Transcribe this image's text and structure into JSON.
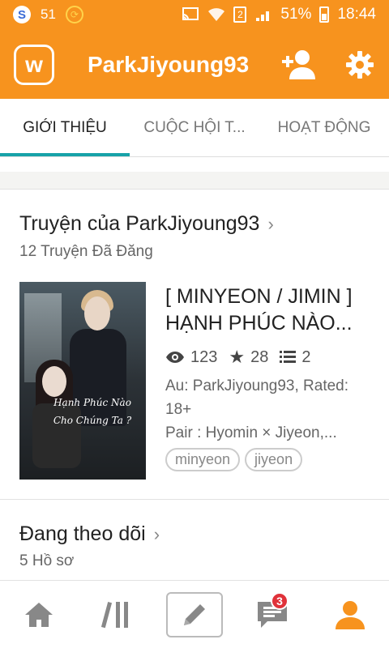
{
  "status_bar": {
    "s_badge": "S",
    "notif_count": "51",
    "sim": "2",
    "battery": "51%",
    "time": "18:44"
  },
  "app_bar": {
    "logo": "w",
    "title": "ParkJiyoung93",
    "accent_color": "#f7931e"
  },
  "tabs": [
    {
      "label": "GIỚI THIỆU",
      "active": true
    },
    {
      "label": "CUỘC HỘI T...",
      "active": false
    },
    {
      "label": "HOẠT ĐỘNG",
      "active": false
    }
  ],
  "stories_section": {
    "title": "Truyện của ParkJiyoung93",
    "subtitle": "12 Truyện Đã Đăng"
  },
  "story": {
    "cover_caption_line1": "Hạnh Phúc Nào",
    "cover_caption_line2": "Cho Chúng Ta ?",
    "title_line1": "[ MINYEON / JIMIN ]",
    "title_line2": "HẠNH PHÚC NÀO...",
    "views": "123",
    "votes": "28",
    "parts": "2",
    "desc_line1": "Au: ParkJiyoung93, Rated:",
    "desc_line2": "18+",
    "desc_line3": "Pair : Hyomin × Jiyeon,...",
    "tags": [
      "minyeon",
      "jiyeon"
    ]
  },
  "following_section": {
    "title": "Đang theo dõi",
    "subtitle": "5 Hồ sơ"
  },
  "bottom_nav": {
    "messages_badge": "3",
    "active_color": "#f7931e"
  }
}
